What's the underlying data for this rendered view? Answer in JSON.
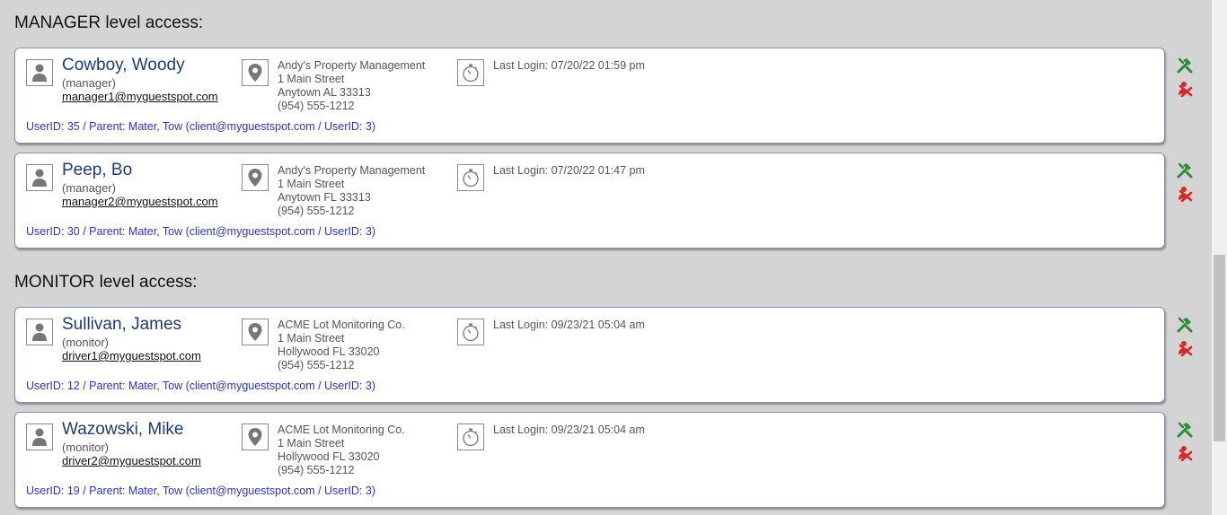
{
  "sections": [
    {
      "title": "MANAGER level access:",
      "users": [
        {
          "name": "Cowboy, Woody",
          "role": "(manager)",
          "email": "manager1@myguestspot.com",
          "company": "Andy's Property Management",
          "street": "1 Main Street",
          "city": "Anytown AL 33313",
          "phone": "(954) 555-1212",
          "last_login": "Last Login: 07/20/22 01:59 pm",
          "meta": "UserID: 35 / Parent: Mater, Tow (client@myguestspot.com / UserID: 3)"
        },
        {
          "name": "Peep, Bo",
          "role": "(manager)",
          "email": "manager2@myguestspot.com",
          "company": "Andy's Property Management",
          "street": "1 Main Street",
          "city": "Anytown FL 33313",
          "phone": "(954) 555-1212",
          "last_login": "Last Login: 07/20/22 01:47 pm",
          "meta": "UserID: 30 / Parent: Mater, Tow (client@myguestspot.com / UserID: 3)"
        }
      ]
    },
    {
      "title": "MONITOR level access:",
      "users": [
        {
          "name": "Sullivan, James",
          "role": "(monitor)",
          "email": "driver1@myguestspot.com",
          "company": "ACME Lot Monitoring Co.",
          "street": "1 Main Street",
          "city": "Hollywood FL 33020",
          "phone": "(954) 555-1212",
          "last_login": "Last Login: 09/23/21 05:04 am",
          "meta": "UserID: 12 / Parent: Mater, Tow (client@myguestspot.com / UserID: 3)"
        },
        {
          "name": "Wazowski, Mike",
          "role": "(monitor)",
          "email": "driver2@myguestspot.com",
          "company": "ACME Lot Monitoring Co.",
          "street": "1 Main Street",
          "city": "Hollywood FL 33020",
          "phone": "(954) 555-1212",
          "last_login": "Last Login: 09/23/21 05:04 am",
          "meta": "UserID: 19 / Parent: Mater, Tow (client@myguestspot.com / UserID: 3)"
        }
      ]
    }
  ],
  "icons": {
    "user": "user-icon",
    "location": "map-pin-icon",
    "timer": "stopwatch-icon",
    "edit": "edit-tools-icon",
    "delete": "delete-user-icon"
  },
  "colors": {
    "name": "#1f3a78",
    "meta": "#2b33c4",
    "edit": "#2e8b3a",
    "delete": "#d62a2a",
    "card_border": "#8a8fb0"
  }
}
